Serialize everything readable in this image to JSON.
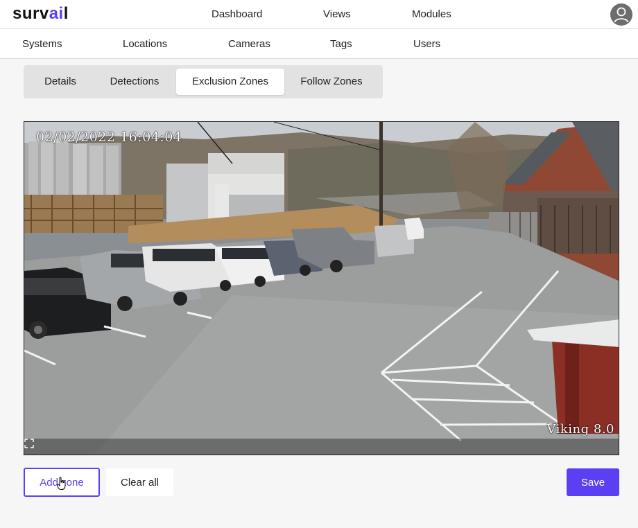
{
  "app": {
    "logo_text_part1": "surv",
    "logo_text_part2": "ai",
    "logo_text_part3": "l",
    "brand_color": "#5b3ff2"
  },
  "topnav": {
    "items": [
      {
        "label": "Dashboard"
      },
      {
        "label": "Views"
      },
      {
        "label": "Modules"
      }
    ],
    "avatar_icon": "user-avatar-icon"
  },
  "subnav": {
    "items": [
      {
        "label": "Systems"
      },
      {
        "label": "Locations"
      },
      {
        "label": "Cameras"
      },
      {
        "label": "Tags"
      },
      {
        "label": "Users"
      }
    ]
  },
  "tabs": {
    "items": [
      {
        "label": "Details",
        "active": false
      },
      {
        "label": "Detections",
        "active": false
      },
      {
        "label": "Exclusion Zones",
        "active": true
      },
      {
        "label": "Follow Zones",
        "active": false
      }
    ]
  },
  "camera": {
    "timestamp": "02/02/2022  16:04:04",
    "overlay_label": "Viking 8.0",
    "fullscreen_icon": "fullscreen-icon"
  },
  "actions": {
    "add_zone_label": "Add zone",
    "clear_all_label": "Clear all",
    "save_label": "Save"
  }
}
